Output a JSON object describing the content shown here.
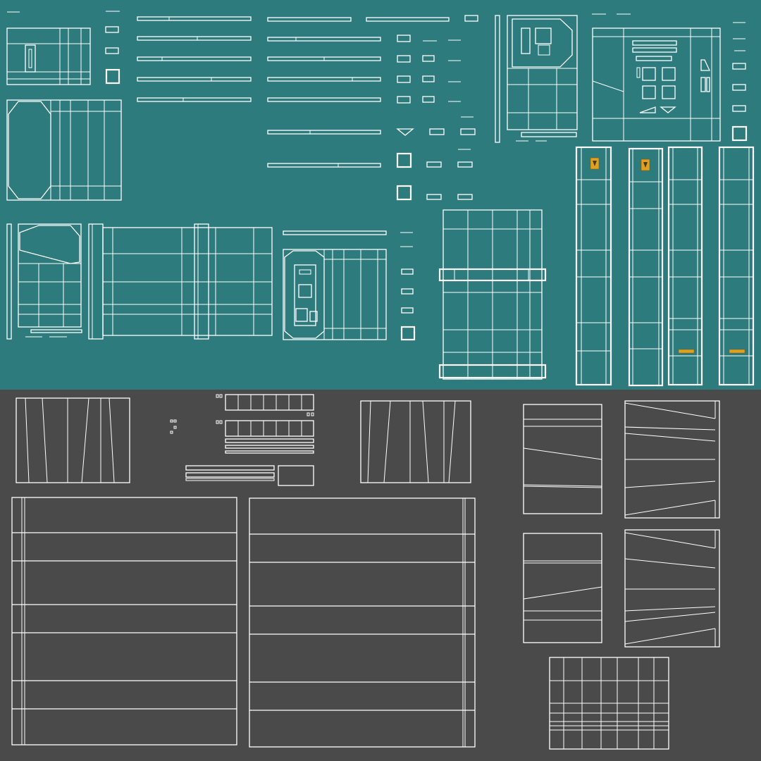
{
  "colors": {
    "top_background": "#2e7b7d",
    "bottom_background": "#4a4a4b",
    "wireframe": "#ffffff",
    "decal": "#e0a020"
  },
  "regions": {
    "top": {
      "texture": "teal-panel-atlas"
    },
    "bottom": {
      "texture": "gray-concrete-atlas"
    }
  },
  "icons": [
    "hazard-decal-icon",
    "label-plate-icon"
  ]
}
